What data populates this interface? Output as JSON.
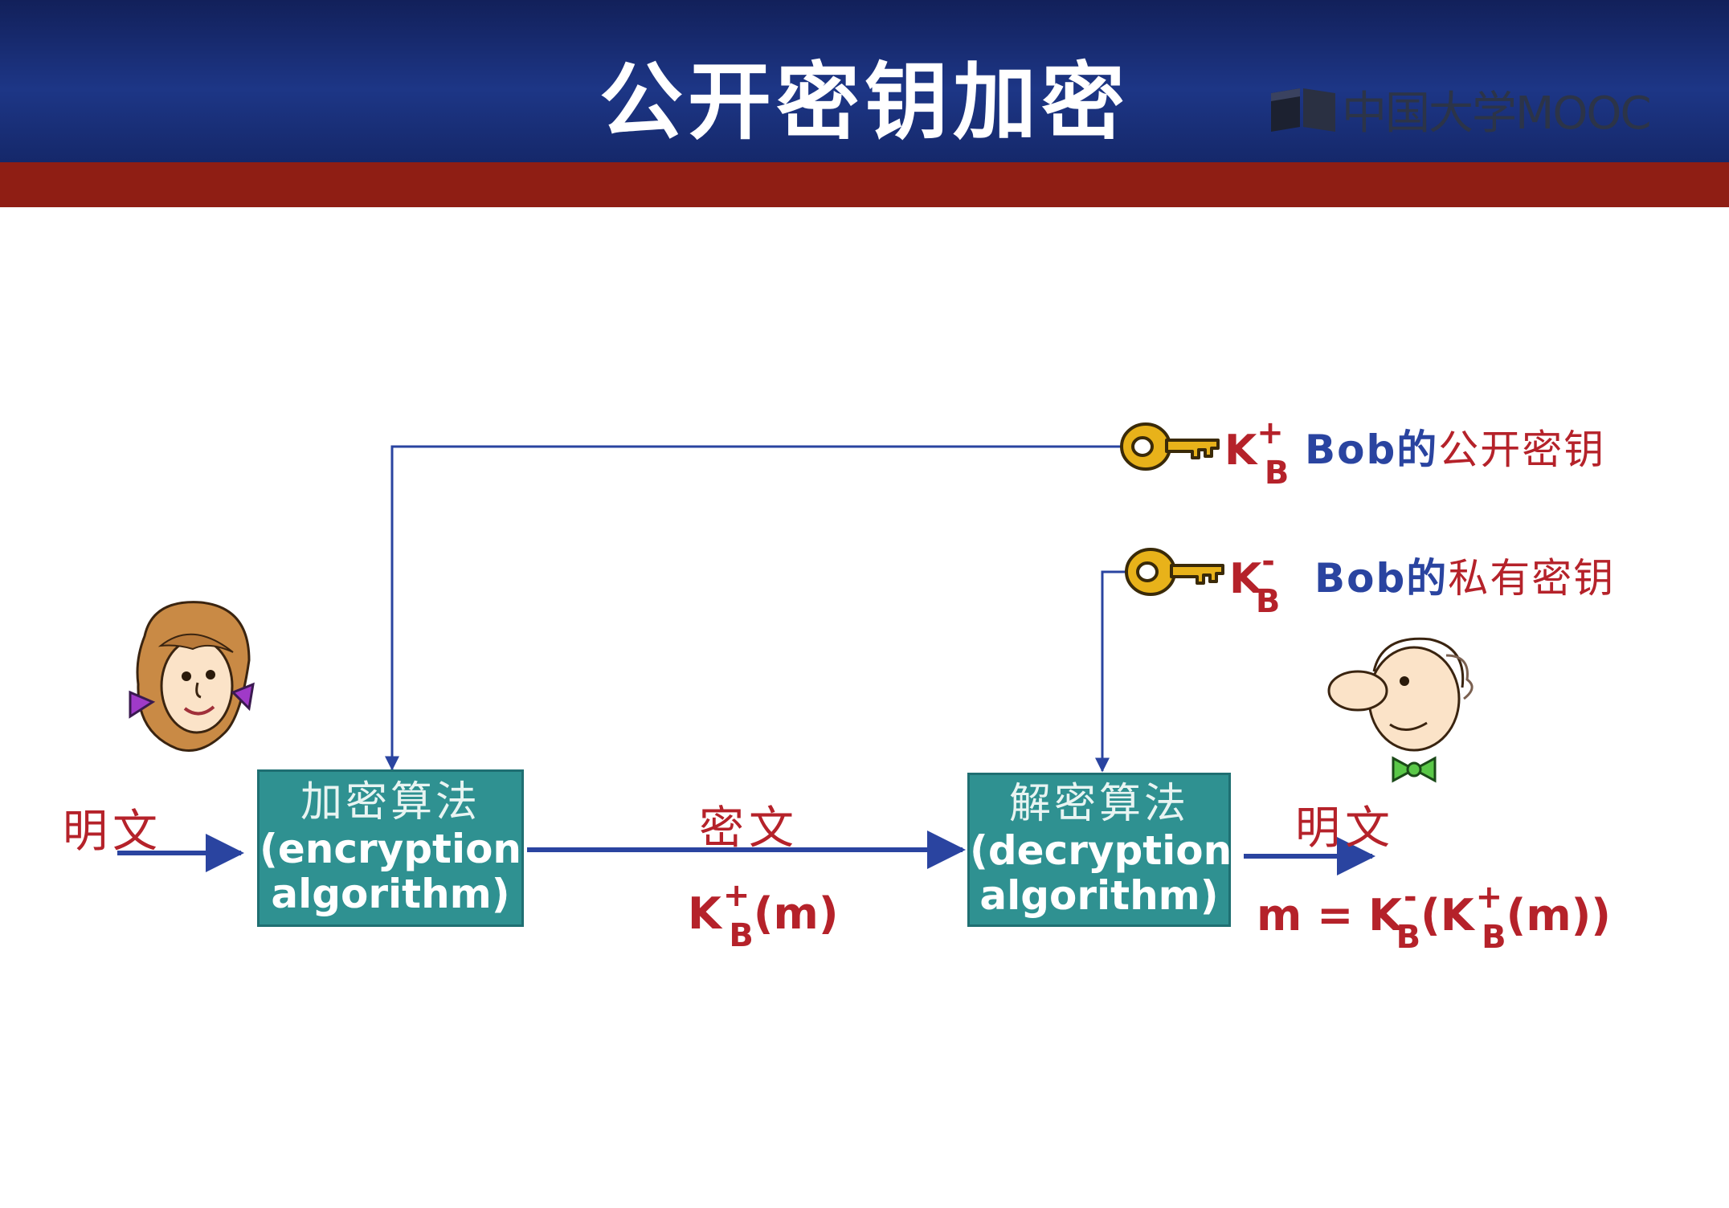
{
  "header": {
    "title": "公开密钥加密",
    "logo_text": "中国大学MOOC"
  },
  "diagram": {
    "plaintext_in": "明文",
    "encrypt_box": {
      "cn": "加密算法",
      "en_line1": "(encryption",
      "en_line2": "algorithm)"
    },
    "ciphertext_label": "密文",
    "cipher_expr": {
      "k": "K",
      "sub": "B",
      "sup": "+",
      "arg": "(m)"
    },
    "decrypt_box": {
      "cn": "解密算法",
      "en_line1": "(decryption",
      "en_line2": "algorithm)"
    },
    "plaintext_out": "明文",
    "result_expr": {
      "lhs": "m = ",
      "k1": "K",
      "sub1": "B",
      "sup1": "-",
      "open": "(",
      "k2": "K",
      "sub2": "B",
      "sup2": "+",
      "arg": "(m))"
    },
    "public_key": {
      "k": "K",
      "sub": "B",
      "sup": "+",
      "owner": "Bob的",
      "desc": "公开密钥"
    },
    "private_key": {
      "k": "K",
      "sub": "B",
      "sup": "-",
      "owner": "Bob的",
      "desc": "私有密钥"
    },
    "characters": [
      "alice-avatar",
      "bob-avatar"
    ]
  },
  "colors": {
    "header_blue": "#1d3686",
    "header_red": "#8f1e14",
    "box_teal": "#2f9191",
    "arrow_blue": "#2a44a0",
    "text_red": "#b5222a",
    "key_gold": "#e8b21a"
  }
}
